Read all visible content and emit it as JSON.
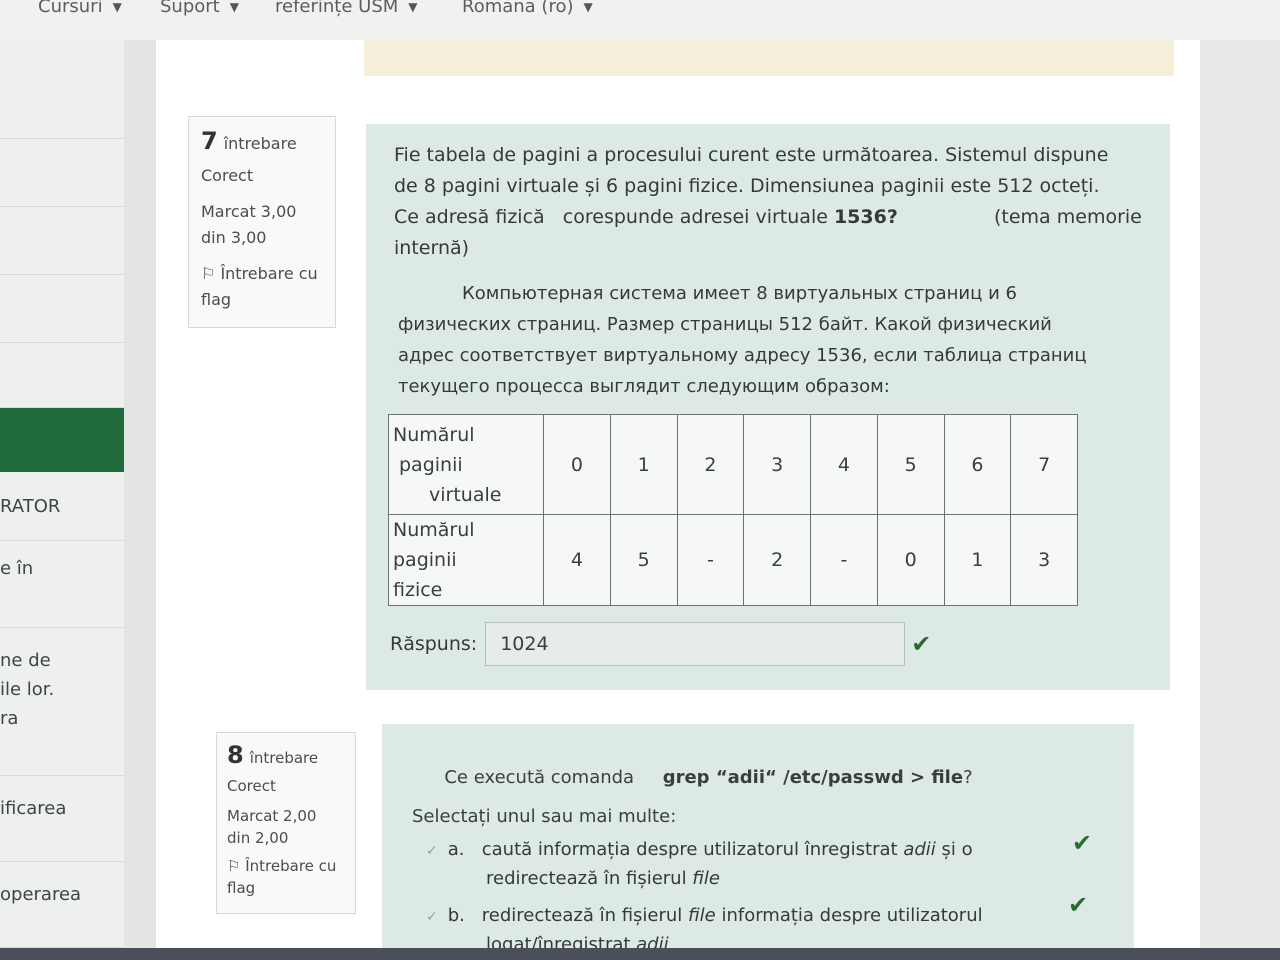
{
  "topnav": {
    "items": [
      {
        "label": "Cursuri",
        "caret": "▼"
      },
      {
        "label": "Suport",
        "caret": "▼"
      },
      {
        "label": "referințe USM",
        "caret": "▼"
      },
      {
        "label": "Romana (ro)",
        "caret": "▼"
      }
    ]
  },
  "sidebar": {
    "items": [
      {
        "label": ""
      },
      {
        "label": ""
      },
      {
        "label": ""
      },
      {
        "label": ""
      },
      {
        "label": ""
      },
      {
        "label": ""
      },
      {
        "label": "RATOR"
      },
      {
        "label": "e în"
      },
      {
        "label": "ne de\nile lor.\nra"
      },
      {
        "label": "ificarea"
      },
      {
        "label": "operarea"
      }
    ],
    "active_color": "#1f6b3b"
  },
  "question7": {
    "number": "7",
    "word": "întrebare",
    "state": "Corect",
    "mark_line1": "Marcat 3,00",
    "mark_line2": "din 3,00",
    "flag_line1": "Întrebare cu",
    "flag_line2": "flag",
    "flag_icon": "flag-icon",
    "text_ro_1": "Fie tabela de pagini a procesului curent este următoarea. Sistemul dispune",
    "text_ro_2": "de 8 pagini virtuale și 6 pagini fizice.  Dimensiunea paginii este 512 octeți.",
    "text_ro_3a": "Ce adresă fizică   corespunde adresei virtuale ",
    "text_ro_3b": "1536?",
    "text_ro_3c": "(tema memorie",
    "text_ro_4": "internă)",
    "text_ru_1": "Компьютерная система имеет 8 виртуальных страниц и 6",
    "text_ru_2": "физических страниц. Размер страницы 512 байт. Какой физический",
    "text_ru_3": "адрес соответствует виртуальному адресу 1536, если таблица страниц",
    "text_ru_4": "текущего процесса выглядит следующим образом:",
    "table": {
      "row1_header_1": "Numărul",
      "row1_header_2": "paginii",
      "row1_header_3": "virtuale",
      "row1": [
        "0",
        "1",
        "2",
        "3",
        "4",
        "5",
        "6",
        "7"
      ],
      "row2_header_1": "Numărul paginii",
      "row2_header_2": "fizice",
      "row2": [
        "4",
        "5",
        "-",
        "2",
        "-",
        "0",
        "1",
        "3"
      ]
    },
    "answer_label": "Răspuns:",
    "answer_value": "1024",
    "answer_check": "✔"
  },
  "question8": {
    "number": "8",
    "word": "întrebare",
    "state": "Corect",
    "mark_line1": "Marcat 2,00",
    "mark_line2": "din 2,00",
    "flag_line1": "Întrebare cu",
    "flag_line2": "flag",
    "flag_icon": "flag-icon",
    "prompt_a": "Ce execută comanda",
    "prompt_cmd": "grep “adii“ /etc/passwd > file",
    "prompt_q": "?",
    "select_label": "Selectați unul sau mai multe:",
    "options": [
      {
        "letter": "a.",
        "text_1a": "caută informația despre utilizatorul înregistrat ",
        "text_1b": "adii",
        "text_1c": " și o",
        "text_2a": "redirectează în fișierul ",
        "text_2b": "file",
        "check": "✔"
      },
      {
        "letter": "b.",
        "text_1a": "redirectează în fișierul ",
        "text_1b": "file",
        "text_1c": " informația despre utilizatorul",
        "text_2a": "logat/înregistrat ",
        "text_2b": "adii",
        "check": "✔"
      }
    ]
  }
}
